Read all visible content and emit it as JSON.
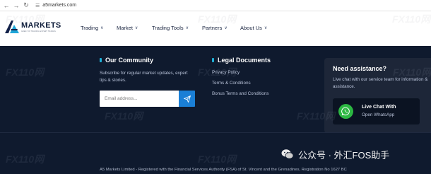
{
  "browser": {
    "back_icon": "arrow-left-icon",
    "forward_icon": "arrow-right-icon",
    "reload_icon": "reload-icon",
    "url": "a5markets.com"
  },
  "header": {
    "logo_title": "MARKETS",
    "logo_subtitle": "GREAT IN TRADING EXPERT TRADES",
    "nav": [
      {
        "label": "Trading"
      },
      {
        "label": "Market"
      },
      {
        "label": "Trading Tools"
      },
      {
        "label": "Partners"
      },
      {
        "label": "About Us"
      }
    ]
  },
  "footer": {
    "community": {
      "title": "Our Community",
      "text": "Subscribe for regular market updates, expert tips & stories.",
      "email_placeholder": "Email address...",
      "send_icon": "paper-plane-icon"
    },
    "legal_documents": {
      "title": "Legal Documents",
      "links": [
        "Privacy Policy",
        "Terms & Conditions",
        "Bonus Terms and Conditions"
      ]
    },
    "assistance": {
      "title": "Need assistance?",
      "text": "Live chat with our service team for information & assistance.",
      "chat_title": "Live Chat With",
      "chat_subtitle": "Open WhatsApp",
      "chat_icon": "whatsapp-icon"
    },
    "legal_notice": "A5 Markets Limited - Registered with the Financial Services Authority (FSA) of St. Vincent and the Grenadines, Registration No 1627 BC"
  },
  "watermark": {
    "text": "FX110网",
    "wechat_text": "公众号 · 外汇FOS助手"
  },
  "colors": {
    "footer_bg": "#0f1a2e",
    "accent_blue": "#1a7fd6",
    "whatsapp_green": "#2cb742",
    "header_bg": "#ffffff"
  }
}
